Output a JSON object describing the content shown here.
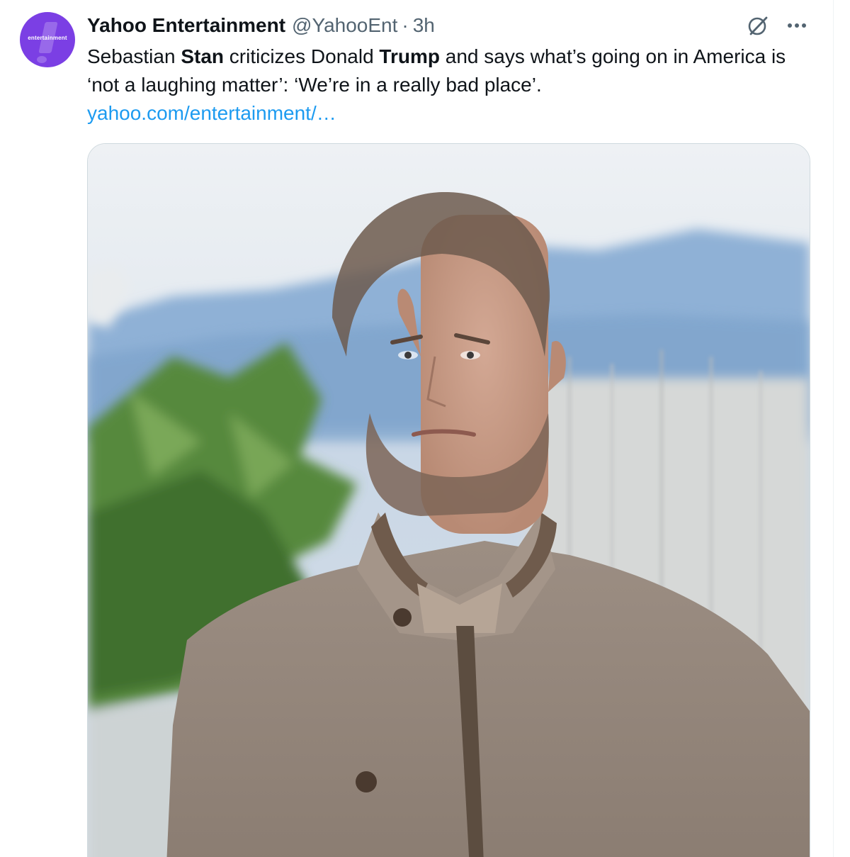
{
  "tweet": {
    "author": {
      "display_name": "Yahoo Entertainment",
      "handle": "@YahooEnt",
      "separator": "·",
      "time": "3h",
      "avatar_text": "entertainment"
    },
    "text": {
      "p1": "Sebastian ",
      "b1": "Stan",
      "p2": " criticizes Donald ",
      "b2": "Trump",
      "p3": " and says what’s going on in America is ‘not a laughing matter’: ‘We’re in a really bad place’."
    },
    "link": "yahoo.com/entertainment/…",
    "icons": {
      "grok": "grok-icon",
      "more": "more-dots-icon"
    },
    "colors": {
      "avatar_bg": "#7b3fe4",
      "link": "#1d9bf0",
      "secondary_text": "#536471"
    }
  }
}
